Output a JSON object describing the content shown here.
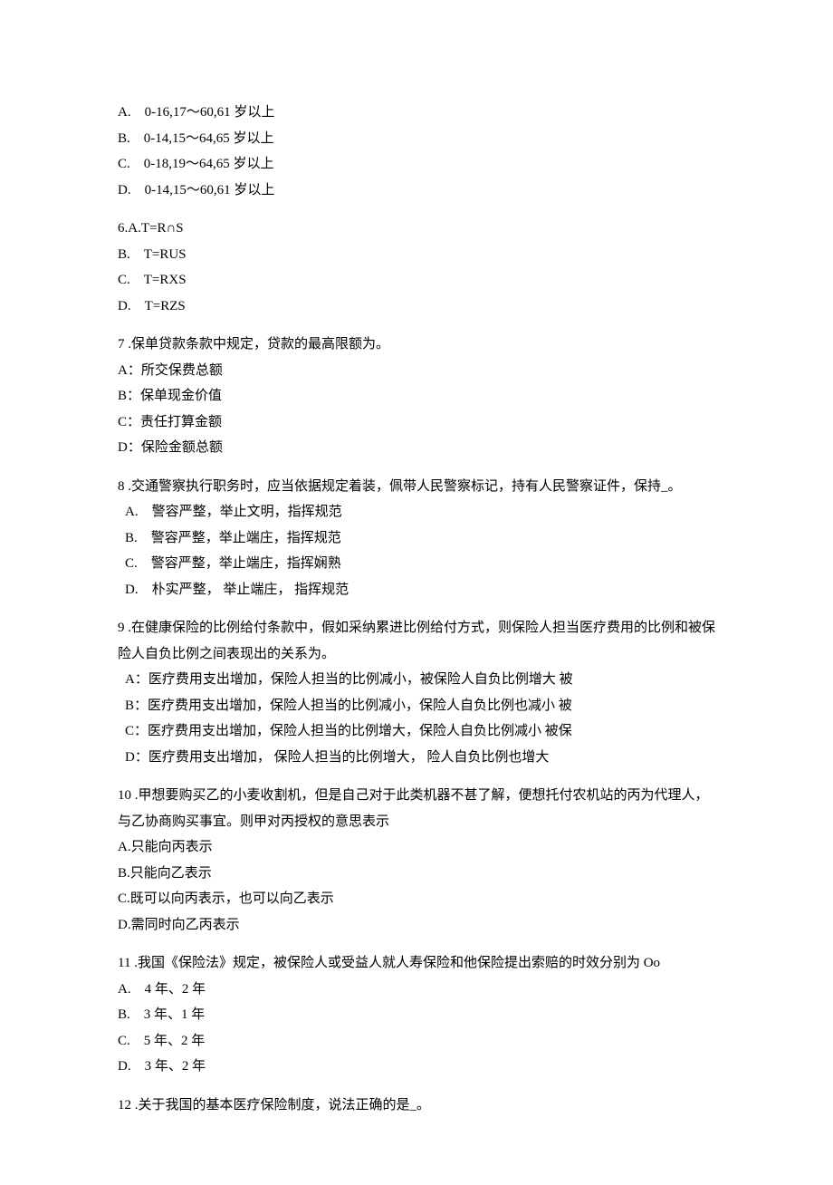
{
  "q5_partial": {
    "options": [
      "A.　0-16,17～60,61 岁以上",
      "B.　0-14,15～64,65 岁以上",
      "C.　0-18,19～64,65 岁以上",
      "D.　0-14,15～60,61 岁以上"
    ]
  },
  "q6": {
    "stem": "6.A.T=R∩S",
    "options": [
      "B.　T=RUS",
      "C.　T=RXS",
      "D.　T=RZS"
    ]
  },
  "q7": {
    "stem": "7  .保单贷款条款中规定，贷款的最高限额为。",
    "options": [
      "A：所交保费总额",
      "B：保单现金价值",
      "C：责任打算金额",
      "D：保险金额总额"
    ]
  },
  "q8": {
    "stem": "8  .交通警察执行职务时，应当依据规定着装，佩带人民警察标记，持有人民警察证件，保持_。",
    "options": [
      "A.　警容严整，举止文明，指挥规范",
      "B.　警容严整，举止端庄，指挥规范",
      "C.　警容严整，举止端庄，指挥娴熟",
      "D.　朴实严整，  举止端庄，  指挥规范"
    ]
  },
  "q9": {
    "stem": "9  .在健康保险的比例给付条款中，假如采纳累进比例给付方式，则保险人担当医疗费用的比例和被保险人自负比例之间表现出的关系为。",
    "options": [
      "A：医疗费用支出增加，保险人担当的比例减小，被保险人自负比例增大  被",
      "B：医疗费用支出增加，保险人担当的比例减小，保险人自负比例也减小  被",
      "C：医疗费用支出增加，保险人担当的比例增大，保险人自负比例减小  被保",
      "D：医疗费用支出增加，  保险人担当的比例增大，  险人自负比例也增大"
    ]
  },
  "q10": {
    "stem": "10  .甲想要购买乙的小麦收割机，但是自己对于此类机器不甚了解，便想托付农机站的丙为代理人，与乙协商购买事宜。则甲对丙授权的意思表示",
    "options": [
      "A.只能向丙表示",
      "B.只能向乙表示",
      "C.既可以向丙表示，也可以向乙表示",
      "D.需同时向乙丙表示"
    ]
  },
  "q11": {
    "stem": "11  .我国《保险法》规定，被保险人或受益人就人寿保险和他保险提出索赔的时效分别为 Oo",
    "options": [
      "A.　4 年、2 年",
      "B.　3 年、1 年",
      "C.　5 年、2 年",
      "D.　3 年、2 年"
    ]
  },
  "q12": {
    "stem": "12  .关于我国的基本医疗保险制度，说法正确的是_。"
  }
}
